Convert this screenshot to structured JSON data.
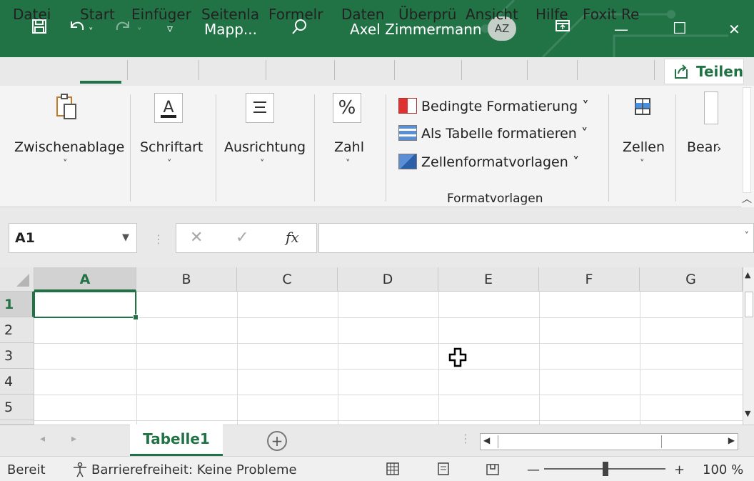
{
  "titlebar": {
    "save_icon": "save-icon",
    "undo_icon": "undo-icon",
    "redo_icon": "redo-icon",
    "qat_icon": "customize-qat-icon",
    "doc_title": "Mapp...",
    "search_icon": "search-icon",
    "user_name": "Axel Zimmermann",
    "user_initials": "AZ",
    "ribbon_display_icon": "ribbon-display-icon",
    "minimize_glyph": "—",
    "maximize_glyph": "☐",
    "close_glyph": "✕",
    "bg_color": "#217346"
  },
  "tabs": [
    "Datei",
    "Start",
    "Einfüger",
    "Seitenla",
    "Formelr",
    "Daten",
    "Überprü",
    "Ansicht",
    "Hilfe",
    "Foxit Re"
  ],
  "share_label": "Teilen",
  "ribbon": {
    "clipboard": "Zwischenablage",
    "font": "Schriftart",
    "alignment": "Ausrichtung",
    "number": "Zahl",
    "styles_items": [
      "Bedingte Formatierung ˅",
      "Als Tabelle formatieren ˅",
      "Zellenformatvorlagen ˅"
    ],
    "styles_group": "Formatvorlagen",
    "cells": "Zellen",
    "editing": "Bear",
    "more": "›",
    "chev": "˅"
  },
  "formula_bar": {
    "name_box": "A1",
    "cancel": "✕",
    "enter": "✓",
    "fx": "fx",
    "formula": ""
  },
  "grid": {
    "columns": [
      "A",
      "B",
      "C",
      "D",
      "E",
      "F",
      "G"
    ],
    "rows": [
      "1",
      "2",
      "3",
      "4",
      "5"
    ],
    "active_cell": "A1"
  },
  "sheets": {
    "tabs": [
      "Tabelle1"
    ],
    "add": "+",
    "nav_prev": "◂",
    "nav_next": "▸"
  },
  "status": {
    "ready": "Bereit",
    "accessibility": "Barrierefreiheit: Keine Probleme",
    "zoom_minus": "—",
    "zoom_plus": "+",
    "zoom": "100 %"
  }
}
